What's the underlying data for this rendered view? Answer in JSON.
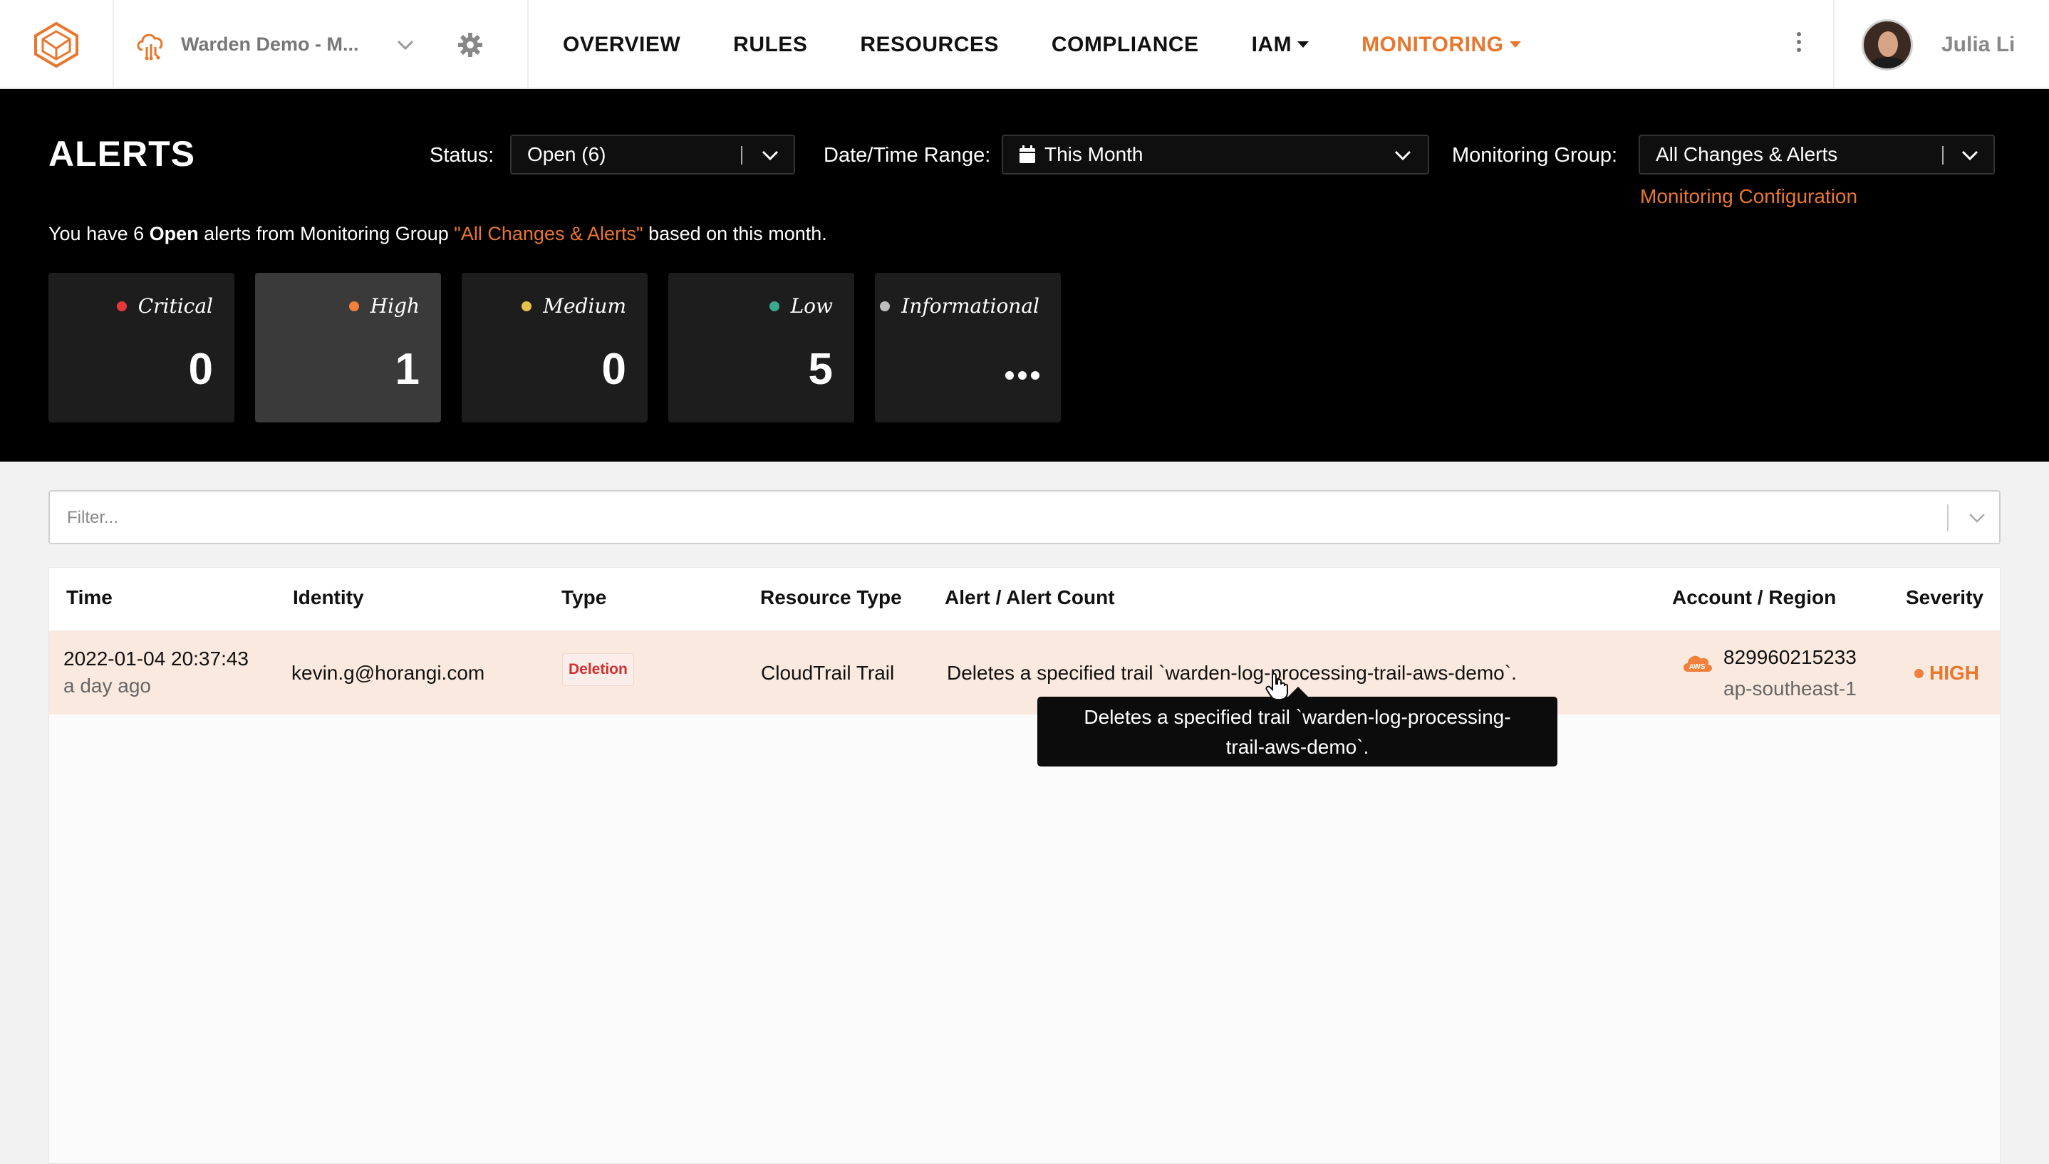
{
  "nav": {
    "org_name": "Warden Demo - M...",
    "links": [
      "OVERVIEW",
      "RULES",
      "RESOURCES",
      "COMPLIANCE",
      "IAM",
      "MONITORING"
    ],
    "active": "MONITORING",
    "user_name": "Julia Li"
  },
  "header": {
    "title": "ALERTS",
    "status_label": "Status:",
    "status_value": "Open (6)",
    "date_label": "Date/Time Range:",
    "date_value": "This Month",
    "group_label": "Monitoring Group:",
    "group_value": "All Changes & Alerts",
    "config_link": "Monitoring Configuration",
    "summary": {
      "pre": "You have 6 ",
      "status": "Open",
      "mid": " alerts from Monitoring Group ",
      "group": "\"All Changes & Alerts\"",
      "post": " based on this month."
    }
  },
  "severity_cards": [
    {
      "label": "Critical",
      "count": "0",
      "color": "#e5383b"
    },
    {
      "label": "High",
      "count": "1",
      "color": "#f0803c"
    },
    {
      "label": "Medium",
      "count": "0",
      "color": "#e5c04a"
    },
    {
      "label": "Low",
      "count": "5",
      "color": "#3aa98c"
    },
    {
      "label": "Informational",
      "count": "",
      "color": "#bdbdbd"
    }
  ],
  "filter": {
    "placeholder": "Filter..."
  },
  "table": {
    "columns": [
      "Time",
      "Identity",
      "Type",
      "Resource Type",
      "Alert / Alert Count",
      "Account / Region",
      "Severity"
    ],
    "rows": [
      {
        "time": "2022-01-04 20:37:43",
        "time_ago": "a day ago",
        "identity": "kevin.g@horangi.com",
        "type": "Deletion",
        "resource_type": "CloudTrail Trail",
        "alert": "Deletes a specified trail `warden-log-processing-trail-aws-demo`.",
        "account": "829960215233",
        "region": "ap-southeast-1",
        "severity": "HIGH",
        "provider": "AWS"
      }
    ]
  },
  "tooltip": {
    "line1": "Deletes a specified trail `warden-log-processing-",
    "line2": "trail-aws-demo`."
  },
  "colors": {
    "accent": "#e8772e",
    "high": "#f0803c"
  }
}
